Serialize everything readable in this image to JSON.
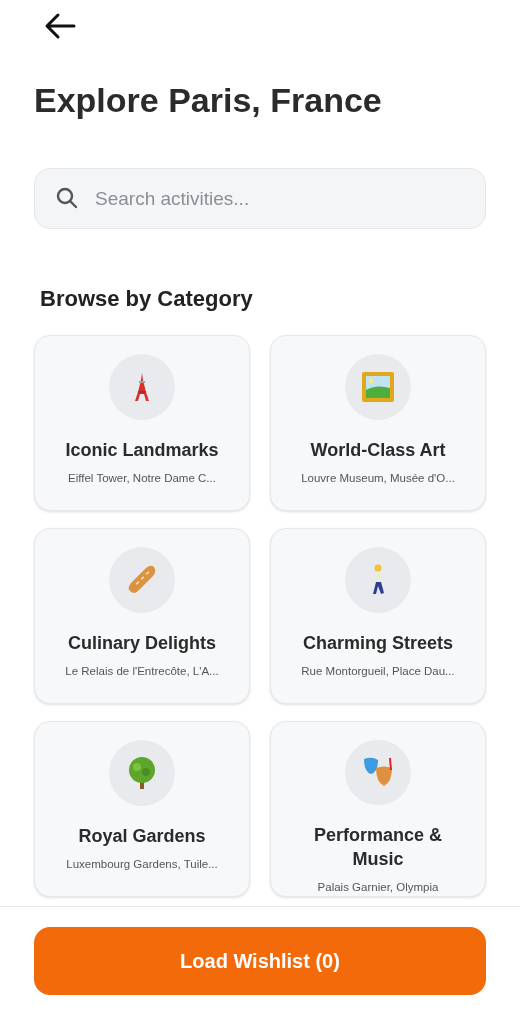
{
  "header": {
    "title": "Explore Paris, France"
  },
  "search": {
    "placeholder": "Search activities..."
  },
  "section_title": "Browse by Category",
  "categories": [
    {
      "kind": "tower",
      "title": "Iconic Landmarks",
      "subtitle": "Eiffel Tower, Notre Dame C..."
    },
    {
      "kind": "frame",
      "title": "World-Class Art",
      "subtitle": "Louvre Museum, Musée d'O..."
    },
    {
      "kind": "bread",
      "title": "Culinary Delights",
      "subtitle": "Le Relais de l'Entrecôte, L'A..."
    },
    {
      "kind": "walker",
      "title": "Charming Streets",
      "subtitle": "Rue Montorgueil, Place Dau..."
    },
    {
      "kind": "tree",
      "title": "Royal Gardens",
      "subtitle": "Luxembourg Gardens, Tuile..."
    },
    {
      "kind": "masks",
      "title": "Performance & Music",
      "subtitle": "Palais Garnier, Olympia"
    }
  ],
  "footer_button": "Load Wishlist (0)"
}
